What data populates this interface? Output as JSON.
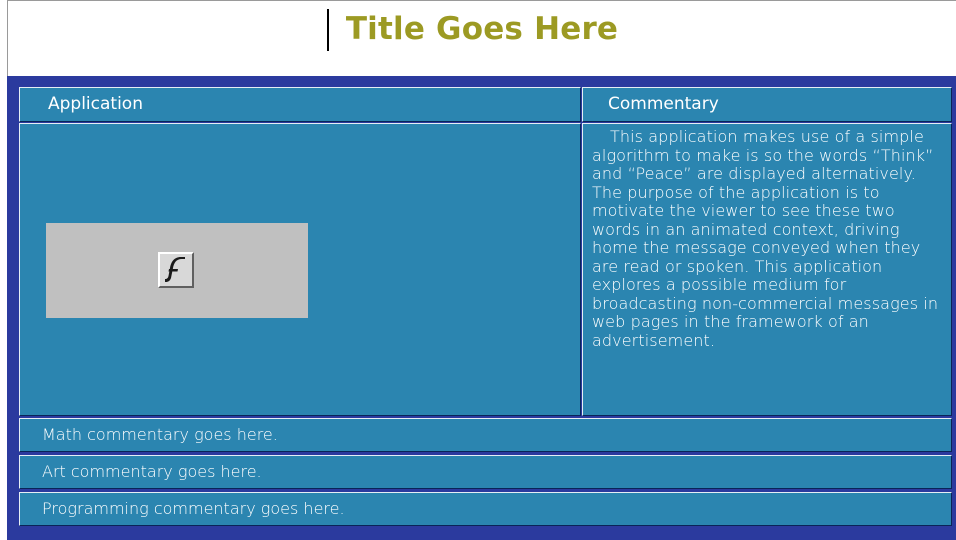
{
  "page": {
    "title": "Title Goes Here"
  },
  "table": {
    "headers": {
      "application": "Application",
      "commentary": "Commentary"
    },
    "application_cell": {
      "plugin_icon": "flash-icon"
    },
    "commentary_text": "This application makes use of a simple algorithm to make is so the words “Think” and “Peace” are displayed alternatively. The purpose of the application is to motivate the viewer to see these two words in an animated context, driving home the message conveyed when they are read or spoken. This application explores a possible medium for broadcasting non-commercial messages in web pages in the framework of an advertisement.",
    "rows": [
      "Math commentary goes here.",
      "Art commentary goes here.",
      "Programming commentary goes here."
    ]
  },
  "colors": {
    "title": "#9c9a23",
    "table_border": "#2b3a9e",
    "cell_background": "#2b85b0",
    "plugin_placeholder": "#c0c0c0"
  }
}
